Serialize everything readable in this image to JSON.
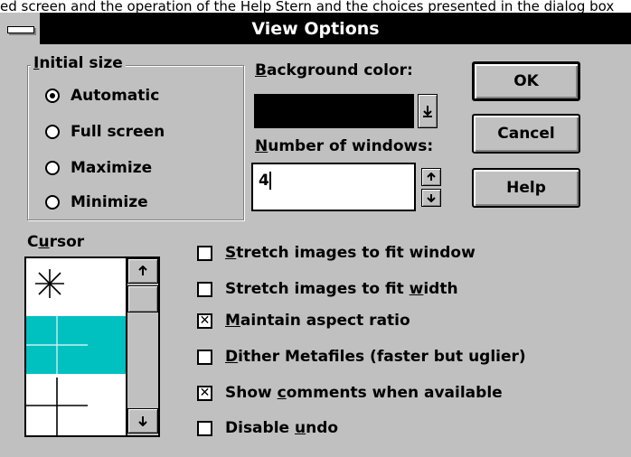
{
  "partial_text_above": "ed screen and the operation of the Help Stern and the choices presented in the dialog box",
  "window": {
    "title": "View Options"
  },
  "initial_size": {
    "legend_prefix": "I",
    "legend_rest": "nitial size",
    "options": [
      {
        "label": "Automatic",
        "selected": true
      },
      {
        "label": "Full screen",
        "selected": false
      },
      {
        "label": "Maximize",
        "selected": false
      },
      {
        "label": "Minimize",
        "selected": false
      }
    ]
  },
  "background_color": {
    "label_mnemonic": "B",
    "label_rest": "ackground color:",
    "value_color": "#000000"
  },
  "number_of_windows": {
    "label_mnemonic": "N",
    "label_rest": "umber of windows:",
    "value": "4"
  },
  "buttons": {
    "ok": "OK",
    "cancel": "Cancel",
    "help": "Help"
  },
  "cursor": {
    "label_pre": "C",
    "label_mnemonic": "u",
    "label_rest": "rsor",
    "highlight_color": "#00c0c0"
  },
  "checkboxes": [
    {
      "pre": "",
      "mn": "S",
      "post": "tretch images to fit window",
      "checked": false
    },
    {
      "pre": "Stretch images to fit ",
      "mn": "w",
      "post": "idth",
      "checked": false
    },
    {
      "pre": "",
      "mn": "M",
      "post": "aintain aspect ratio",
      "checked": true
    },
    {
      "pre": "",
      "mn": "D",
      "post": "ither Metafiles (faster but uglier)",
      "checked": false
    },
    {
      "pre": "Show ",
      "mn": "c",
      "post": "omments when available",
      "checked": true
    },
    {
      "pre": "Disable ",
      "mn": "u",
      "post": "ndo",
      "checked": false
    }
  ]
}
